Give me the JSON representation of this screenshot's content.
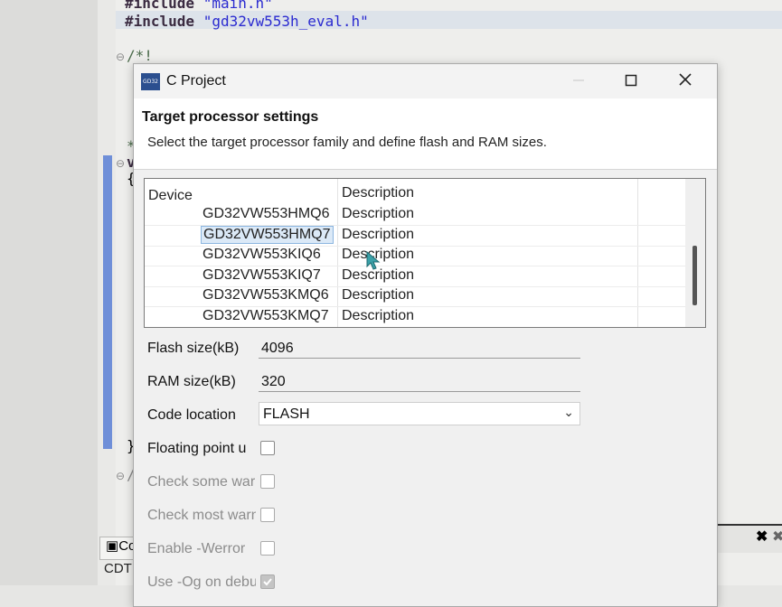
{
  "editor": {
    "line1_kw": "#include",
    "line1_str": "\"main.h\"",
    "line2_kw": "#include",
    "line2_str": "\"gd32vw553h_eval.h\"",
    "comment_start": "/*!",
    "star": "*",
    "brace": "{",
    "brace_close": "}",
    "fold_v": "v",
    "slash": "/",
    "console_tab": "Co",
    "console_label": "CDT"
  },
  "dialog": {
    "icon_text": "GD32",
    "title": "C Project",
    "header_title": "Target processor settings",
    "header_desc": "Select the target processor family and define flash and RAM sizes.",
    "table": {
      "col_device": "Device",
      "col_description": "Description",
      "header_desc_value": "Description",
      "rows": [
        {
          "device": "GD32VW553HMQ6",
          "description": "Description",
          "selected": false
        },
        {
          "device": "GD32VW553HMQ7",
          "description": "Description",
          "selected": true
        },
        {
          "device": "GD32VW553KIQ6",
          "description": "Description",
          "selected": false
        },
        {
          "device": "GD32VW553KIQ7",
          "description": "Description",
          "selected": false
        },
        {
          "device": "GD32VW553KMQ6",
          "description": "Description",
          "selected": false
        },
        {
          "device": "GD32VW553KMQ7",
          "description": "Description",
          "selected": false
        }
      ]
    },
    "flash_label": "Flash size(kB)",
    "flash_value": "4096",
    "ram_label": "RAM size(kB)",
    "ram_value": "320",
    "code_location_label": "Code location",
    "code_location_value": "FLASH",
    "floating_point_label": "Floating point u",
    "check_some_label": "Check some war",
    "check_most_label": "Check most warn",
    "werror_label": "Enable -Werror",
    "og_label": "Use -Og on debu"
  }
}
